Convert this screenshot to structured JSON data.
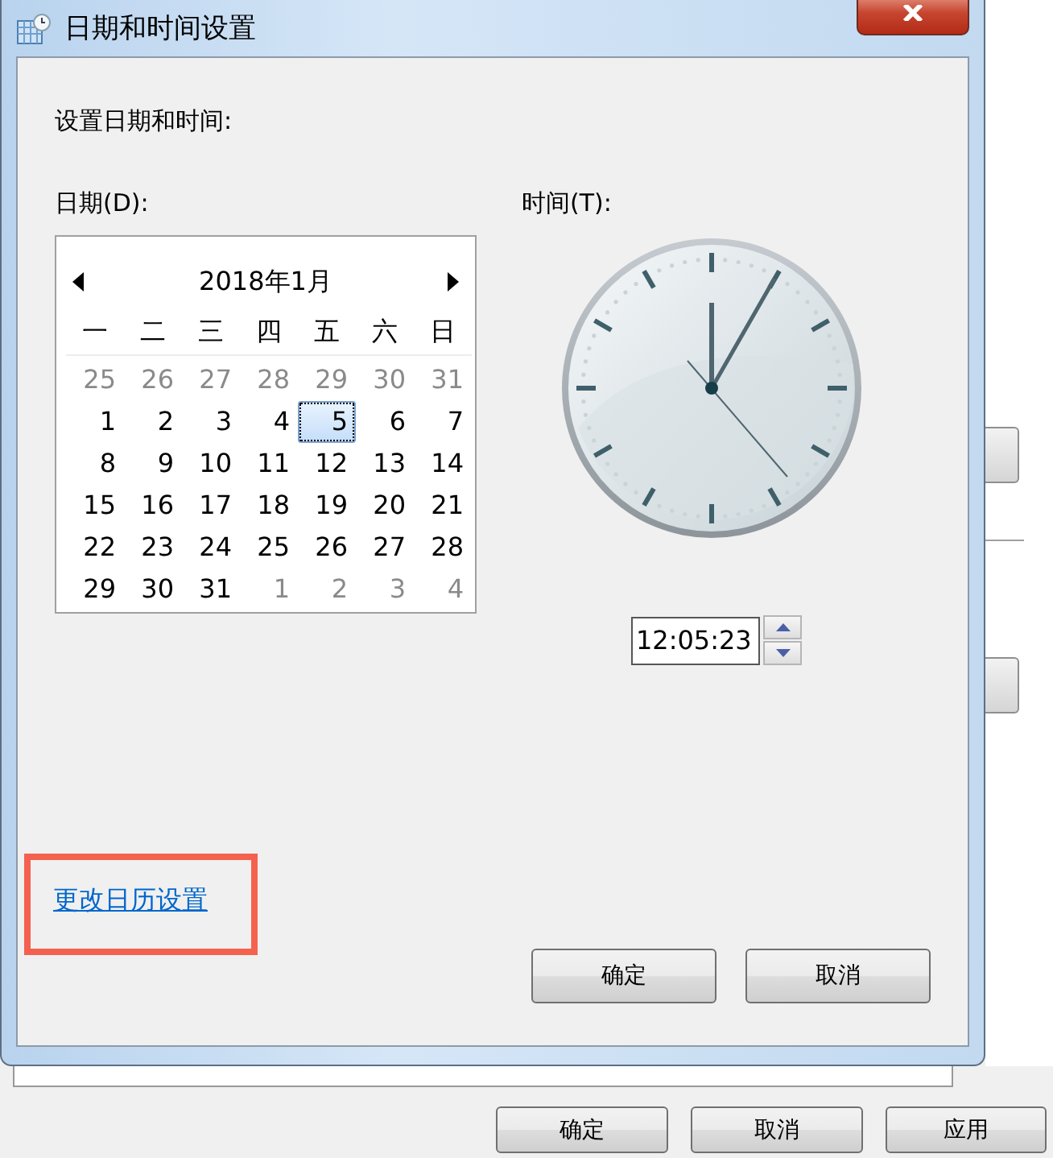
{
  "window": {
    "title": "日期和时间设置"
  },
  "heading": "设置日期和时间:",
  "date": {
    "label": "日期(D):",
    "month": "2018年1月",
    "weekdays": [
      "一",
      "二",
      "三",
      "四",
      "五",
      "六",
      "日"
    ],
    "days": [
      {
        "day": "25",
        "in_month": false,
        "selected": false
      },
      {
        "day": "26",
        "in_month": false,
        "selected": false
      },
      {
        "day": "27",
        "in_month": false,
        "selected": false
      },
      {
        "day": "28",
        "in_month": false,
        "selected": false
      },
      {
        "day": "29",
        "in_month": false,
        "selected": false
      },
      {
        "day": "30",
        "in_month": false,
        "selected": false
      },
      {
        "day": "31",
        "in_month": false,
        "selected": false
      },
      {
        "day": "1",
        "in_month": true,
        "selected": false
      },
      {
        "day": "2",
        "in_month": true,
        "selected": false
      },
      {
        "day": "3",
        "in_month": true,
        "selected": false
      },
      {
        "day": "4",
        "in_month": true,
        "selected": false
      },
      {
        "day": "5",
        "in_month": true,
        "selected": true
      },
      {
        "day": "6",
        "in_month": true,
        "selected": false
      },
      {
        "day": "7",
        "in_month": true,
        "selected": false
      },
      {
        "day": "8",
        "in_month": true,
        "selected": false
      },
      {
        "day": "9",
        "in_month": true,
        "selected": false
      },
      {
        "day": "10",
        "in_month": true,
        "selected": false
      },
      {
        "day": "11",
        "in_month": true,
        "selected": false
      },
      {
        "day": "12",
        "in_month": true,
        "selected": false
      },
      {
        "day": "13",
        "in_month": true,
        "selected": false
      },
      {
        "day": "14",
        "in_month": true,
        "selected": false
      },
      {
        "day": "15",
        "in_month": true,
        "selected": false
      },
      {
        "day": "16",
        "in_month": true,
        "selected": false
      },
      {
        "day": "17",
        "in_month": true,
        "selected": false
      },
      {
        "day": "18",
        "in_month": true,
        "selected": false
      },
      {
        "day": "19",
        "in_month": true,
        "selected": false
      },
      {
        "day": "20",
        "in_month": true,
        "selected": false
      },
      {
        "day": "21",
        "in_month": true,
        "selected": false
      },
      {
        "day": "22",
        "in_month": true,
        "selected": false
      },
      {
        "day": "23",
        "in_month": true,
        "selected": false
      },
      {
        "day": "24",
        "in_month": true,
        "selected": false
      },
      {
        "day": "25",
        "in_month": true,
        "selected": false
      },
      {
        "day": "26",
        "in_month": true,
        "selected": false
      },
      {
        "day": "27",
        "in_month": true,
        "selected": false
      },
      {
        "day": "28",
        "in_month": true,
        "selected": false
      },
      {
        "day": "29",
        "in_month": true,
        "selected": false
      },
      {
        "day": "30",
        "in_month": true,
        "selected": false
      },
      {
        "day": "31",
        "in_month": true,
        "selected": false
      },
      {
        "day": "1",
        "in_month": false,
        "selected": false
      },
      {
        "day": "2",
        "in_month": false,
        "selected": false
      },
      {
        "day": "3",
        "in_month": false,
        "selected": false
      },
      {
        "day": "4",
        "in_month": false,
        "selected": false
      }
    ]
  },
  "time": {
    "label": "时间(T):",
    "value": "12:05:23"
  },
  "link": "更改日历设置",
  "buttons": [
    "确定",
    "取消"
  ],
  "background_window": {
    "buttons": [
      "确定",
      "取消",
      "应用"
    ]
  }
}
